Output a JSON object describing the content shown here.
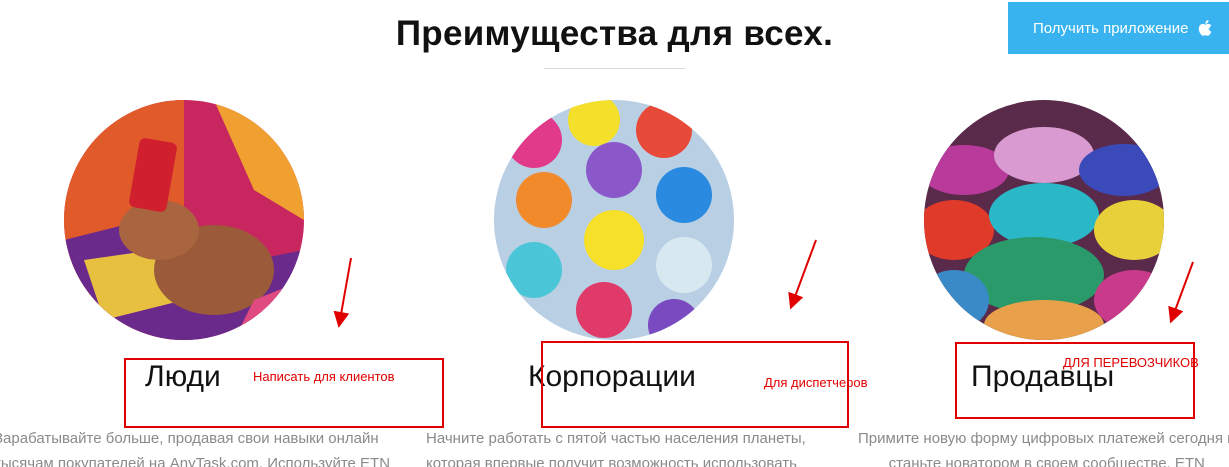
{
  "header": {
    "title": "Преимущества для всех.",
    "get_app_label": "Получить приложение",
    "get_app_icon": "apple-icon",
    "accent_color": "#38b3f0"
  },
  "cards": [
    {
      "heading": "Люди",
      "note": "Написать для клиентов",
      "desc_line1": "Зарабатывайте больше, продавая свои навыки онлайн",
      "desc_line2": "тысячам покупателей на AnyTask.com. Используйте ETN"
    },
    {
      "heading": "Корпорации",
      "note": "Для диспетчеров",
      "desc_line1": "Начните работать с пятой частью населения планеты,",
      "desc_line2": "которая впервые получит возможность использовать"
    },
    {
      "heading": "Продавцы",
      "note": "ДЛЯ ПЕРЕВОЗЧИКОВ",
      "desc_line1": "Примите новую форму цифровых платежей сегодня и",
      "desc_line2": "станьте новатором в своем сообществе. ETN"
    }
  ],
  "annotation_color": "#e00000"
}
